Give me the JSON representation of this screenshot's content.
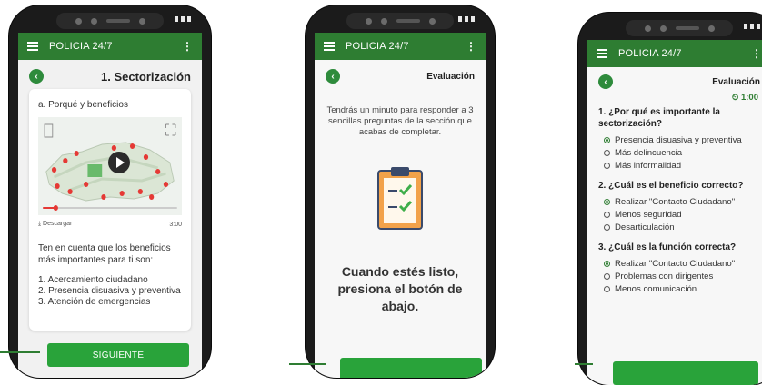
{
  "app_title": "POLICIA 24/7",
  "colors": {
    "brand": "#2e7d32",
    "button": "#29a33a"
  },
  "screen1": {
    "header_title": "1. Sectorización",
    "card_title": "a. Porqué y beneficios",
    "download_label": "Descargar",
    "duration": "3:00",
    "intro": "Ten en cuenta que los beneficios más importantes para ti son:",
    "benefits": [
      "1. Acercamiento ciudadano",
      "2. Presencia disuasiva y preventiva",
      "3. Atención de emergencias"
    ],
    "button_label": "SIGUIENTE"
  },
  "screen2": {
    "header_title": "Evaluación",
    "description": "Tendrás un minuto para responder a 3 sencillas preguntas de la sección que acabas de completar.",
    "cta": "Cuando estés listo, presiona el botón de abajo."
  },
  "screen3": {
    "header_title": "Evaluación",
    "timer": "1:00",
    "questions": [
      {
        "text": "1. ¿Por qué es importante la sectorización?",
        "options": [
          "Presencia disuasiva y preventiva",
          "Más delincuencia",
          "Más informalidad"
        ],
        "selected": 0
      },
      {
        "text": "2. ¿Cuál es el beneficio correcto?",
        "options": [
          "Realizar \"Contacto Ciudadano\"",
          "Menos seguridad",
          "Desarticulación"
        ],
        "selected": 0
      },
      {
        "text": "3. ¿Cuál es la función correcta?",
        "options": [
          "Realizar \"Contacto Ciudadano\"",
          "Problemas con dirigentes",
          "Menos comunicación"
        ],
        "selected": 0
      }
    ]
  }
}
